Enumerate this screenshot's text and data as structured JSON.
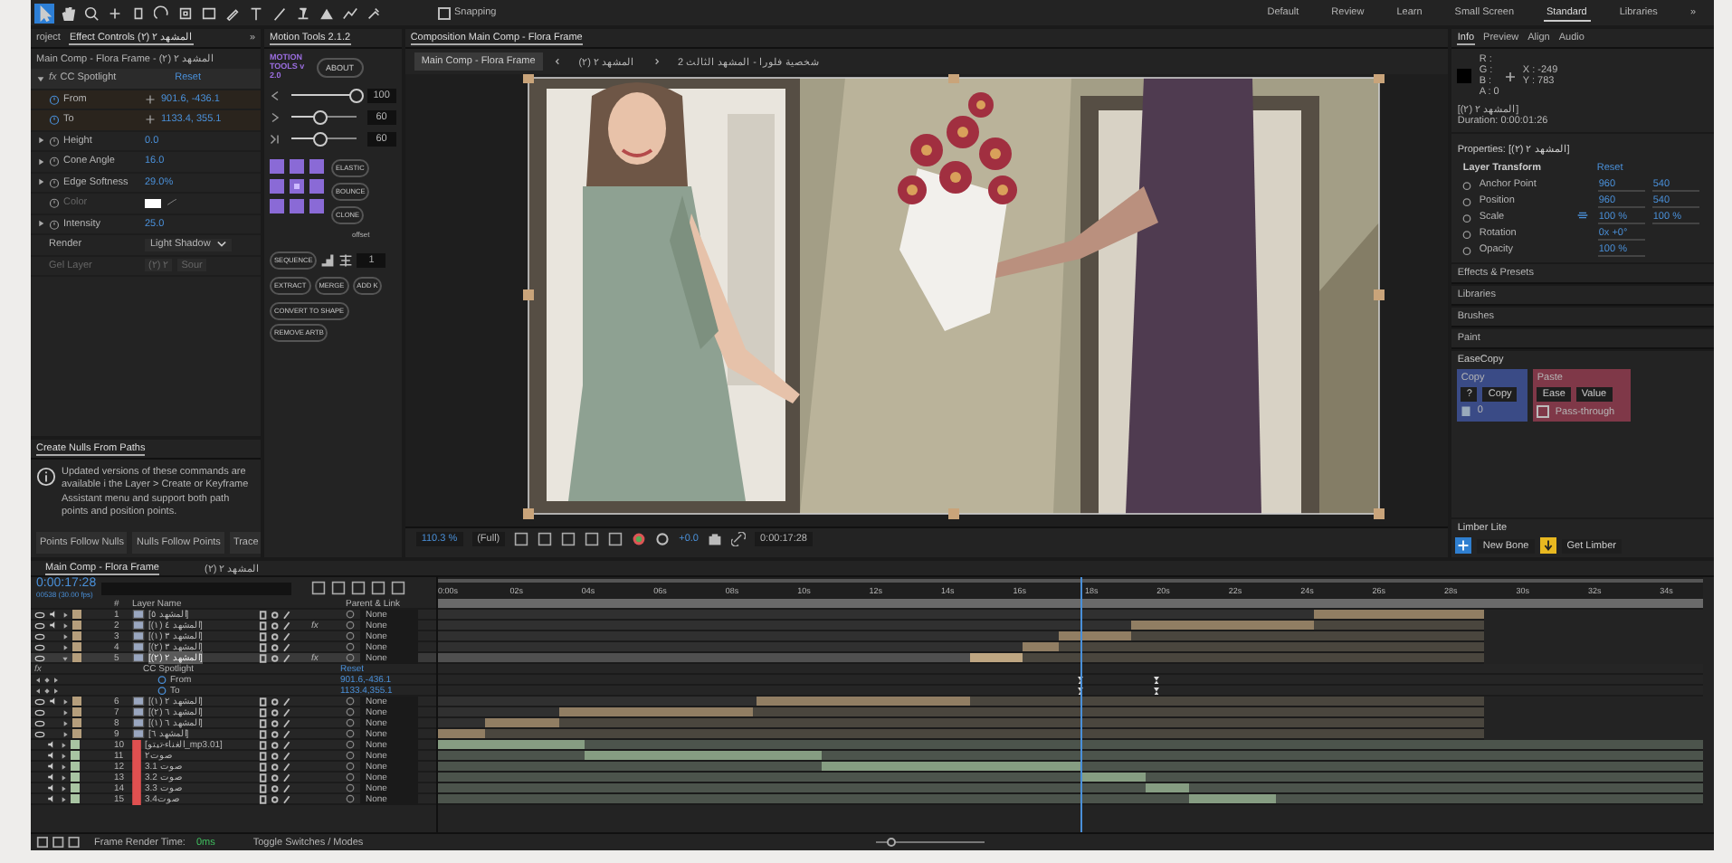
{
  "toolbar": {
    "tools": [
      {
        "selected": true
      },
      {
        "selected": false
      },
      {
        "selected": false
      },
      {
        "selected": false
      },
      {
        "selected": false
      },
      {
        "selected": false
      },
      {
        "selected": false
      },
      {
        "selected": false
      },
      {
        "selected": false
      },
      {
        "selected": false
      },
      {
        "selected": false
      },
      {
        "selected": false
      },
      {
        "selected": false
      },
      {
        "selected": false
      },
      {
        "selected": false
      }
    ],
    "snapping": {
      "label": "Snapping",
      "checked": false
    },
    "workspaces": [
      {
        "label": "Default",
        "selected": false
      },
      {
        "label": "Review",
        "selected": false
      },
      {
        "label": "Learn",
        "selected": false
      },
      {
        "label": "Small Screen",
        "selected": false
      },
      {
        "label": "Standard",
        "selected": true
      },
      {
        "label": "Libraries",
        "selected": false
      }
    ],
    "overflow": "»"
  },
  "effect_controls": {
    "tabs": [
      {
        "label": "roject",
        "selected": false
      },
      {
        "label": "Effect Controls المشهد ٢ (٢)",
        "selected": true
      }
    ],
    "overflow": "»",
    "breadcrumb": "Main Comp - Flora Frame - المشهد ٢ (٢)",
    "effect": {
      "fx_label": "fx",
      "name": "CC Spotlight",
      "reset": "Reset",
      "expanded": true
    },
    "properties": [
      {
        "kind": "point",
        "name": "From",
        "value": "901.6, -436.1",
        "expandable": false,
        "disabled": false
      },
      {
        "kind": "point",
        "name": "To",
        "value": "1133.4, 355.1",
        "expandable": false,
        "disabled": false
      },
      {
        "kind": "number",
        "name": "Height",
        "value": "0.0",
        "expandable": true,
        "disabled": false
      },
      {
        "kind": "number",
        "name": "Cone Angle",
        "value": "16.0",
        "expandable": true,
        "disabled": false
      },
      {
        "kind": "number",
        "name": "Edge Softness",
        "value": "29.0%",
        "expandable": true,
        "disabled": false
      },
      {
        "kind": "color",
        "name": "Color",
        "expandable": false,
        "disabled": true
      },
      {
        "kind": "number",
        "name": "Intensity",
        "value": "25.0",
        "expandable": true,
        "disabled": false
      },
      {
        "kind": "dropdown",
        "name": "Render",
        "value": "Light Shadow",
        "expandable": false,
        "disabled": false
      },
      {
        "kind": "dropdowns",
        "name": "Gel Layer",
        "value": "(٢) ٢",
        "value2": "Sour",
        "expandable": false,
        "disabled": true
      }
    ]
  },
  "create_nulls": {
    "title": "Create Nulls From Paths",
    "message": "Updated versions of these commands are available i the Layer > Create or Keyframe Assistant menu and support both path points and position points.",
    "buttons": [
      "Points Follow Nulls",
      "Nulls Follow Points",
      "Trace"
    ]
  },
  "motion_tools": {
    "title": "Motion Tools 2.1.2",
    "logo": "MOTION TOOLS v 2.0",
    "about": "ABOUT",
    "sliders": [
      {
        "level": 1,
        "value": "100"
      },
      {
        "level": 0.45,
        "value": "60"
      },
      {
        "level": 0.45,
        "value": "60"
      }
    ],
    "side_buttons": [
      "ELASTIC",
      "BOUNCE",
      "CLONE"
    ],
    "offset_label": "offset",
    "sequence": "SEQUENCE",
    "count": "1",
    "row_buttons": [
      "EXTRACT",
      "MERGE",
      "ADD K"
    ],
    "bottom_buttons": [
      "CONVERT TO SHAPE",
      "REMOVE ARTB"
    ]
  },
  "composition": {
    "tab": "Composition Main Comp - Flora Frame",
    "breadcrumbs": {
      "root": {
        "label": "Main Comp - Flora Frame",
        "selected": true
      },
      "middle": {
        "label": "المشهد ٢ (٢)",
        "selected": false
      },
      "end": {
        "label": "شخصية فلورا - المشهد الثالث 2",
        "selected": false
      }
    },
    "zoom": "110.3 %",
    "resolution": "(Full)",
    "exposure": "+0.0",
    "time": "0:00:17:28"
  },
  "info": {
    "tabs": [
      {
        "label": "Info",
        "selected": true
      },
      {
        "label": "Preview",
        "selected": false
      },
      {
        "label": "Align",
        "selected": false
      },
      {
        "label": "Audio",
        "selected": false
      }
    ],
    "channels": [
      "R :",
      "G :",
      "B :",
      "A : 0"
    ],
    "coords": [
      "X : -249",
      "Y : 783"
    ],
    "layer": "[المشهد ٢ (٢)]",
    "duration": "Duration: 0:00:01:26"
  },
  "properties": {
    "title": "Properties: [المشهد ٢ (٢)]",
    "group": "Layer Transform",
    "reset": "Reset",
    "rows": [
      {
        "name": "Anchor Point",
        "values": [
          "960",
          "540"
        ],
        "linked": false
      },
      {
        "name": "Position",
        "values": [
          "960",
          "540"
        ],
        "linked": false
      },
      {
        "name": "Scale",
        "values": [
          "100 %",
          "100 %"
        ],
        "linked": true
      },
      {
        "name": "Rotation",
        "values": [
          "0x +0°"
        ],
        "linked": false
      },
      {
        "name": "Opacity",
        "values": [
          "100 %"
        ],
        "linked": false
      }
    ]
  },
  "panels": [
    "Effects & Presets",
    "Libraries",
    "Brushes",
    "Paint"
  ],
  "easecopy": {
    "title": "EaseCopy",
    "copy_label": "Copy",
    "help": "?",
    "copy_button": "Copy",
    "count": "0",
    "paste_label": "Paste",
    "paste_buttons": [
      "Ease",
      "Value"
    ],
    "pass_through": {
      "label": "Pass-through",
      "checked": false
    }
  },
  "limber": {
    "title": "Limber Lite",
    "buttons": [
      {
        "kind": "bone",
        "label": "New Bone"
      },
      {
        "kind": "get",
        "label": "Get Limber"
      }
    ]
  },
  "timeline": {
    "tabs": [
      {
        "label": "Main Comp - Flora Frame",
        "selected": true
      },
      {
        "label": "المشهد ٢ (٢)",
        "selected": false
      }
    ],
    "time": "0:00:17:28",
    "frames": "00538 (30.00 fps)",
    "columns": {
      "number": "#",
      "name": "Layer Name",
      "parent": "Parent & Link"
    },
    "ticks": [
      "0:00s",
      "02s",
      "04s",
      "06s",
      "08s",
      "10s",
      "12s",
      "14s",
      "16s",
      "18s",
      "20s",
      "22s",
      "24s",
      "26s",
      "28s",
      "30s",
      "32s",
      "34s"
    ],
    "layers": [
      {
        "num": "1",
        "name": "[المشهد ٥]",
        "kind": "comp",
        "video": true,
        "audio": true,
        "fx": false,
        "selected": false,
        "expanded": false,
        "color": "#b59e7c",
        "parent": "None"
      },
      {
        "num": "2",
        "name": "[المشهد ٤ (١)]",
        "kind": "comp",
        "video": true,
        "audio": true,
        "fx": "fx",
        "selected": false,
        "expanded": false,
        "color": "#b59e7c",
        "parent": "None"
      },
      {
        "num": "3",
        "name": "[المشهد ٣ (١)]",
        "kind": "comp",
        "video": true,
        "audio": false,
        "fx": false,
        "selected": false,
        "expanded": false,
        "color": "#b59e7c",
        "parent": "None"
      },
      {
        "num": "4",
        "name": "[المشهد ٣ (٢)]",
        "kind": "comp",
        "video": true,
        "audio": false,
        "fx": false,
        "selected": false,
        "expanded": false,
        "color": "#b59e7c",
        "parent": "None"
      },
      {
        "num": "5",
        "name": "[المشهد ٢ (٢)]",
        "kind": "comp",
        "video": true,
        "audio": false,
        "fx": "fx",
        "selected": true,
        "expanded": true,
        "color": "#b59e7c",
        "parent": "None",
        "effects": [
          {
            "fx_label": "fx",
            "name": "CC Spotlight",
            "reset": "Reset",
            "properties": [
              {
                "name": "From",
                "value": "901.6,-436.1"
              },
              {
                "name": "To",
                "value": "1133.4,355.1"
              }
            ]
          }
        ]
      },
      {
        "num": "6",
        "name": "[المشهد ٢ (١)]",
        "kind": "comp",
        "video": true,
        "audio": true,
        "fx": false,
        "selected": false,
        "expanded": false,
        "color": "#b59e7c",
        "parent": "None"
      },
      {
        "num": "7",
        "name": "[المشهد ٦ (٢)]",
        "kind": "comp",
        "video": true,
        "audio": false,
        "fx": false,
        "selected": false,
        "expanded": false,
        "color": "#b59e7c",
        "parent": "None"
      },
      {
        "num": "8",
        "name": "[المشهد ٦ (١)]",
        "kind": "comp",
        "video": true,
        "audio": false,
        "fx": false,
        "selected": false,
        "expanded": false,
        "color": "#b59e7c",
        "parent": "None"
      },
      {
        "num": "9",
        "name": "[المشهد ٦]",
        "kind": "comp",
        "video": true,
        "audio": false,
        "fx": false,
        "selected": false,
        "expanded": false,
        "color": "#b59e7c",
        "parent": "None"
      },
      {
        "num": "10",
        "name": "[الغناء-تيتو_mp3.01]",
        "kind": "audio",
        "video": false,
        "audio": true,
        "fx": false,
        "selected": false,
        "expanded": false,
        "color": "#a8c4a2",
        "parent": "None"
      },
      {
        "num": "11",
        "name": "صوت٢",
        "kind": "audio",
        "video": false,
        "audio": true,
        "fx": false,
        "selected": false,
        "expanded": false,
        "color": "#a8c4a2",
        "parent": "None"
      },
      {
        "num": "12",
        "name": "صوت 3.1",
        "kind": "audio",
        "video": false,
        "audio": true,
        "fx": false,
        "selected": false,
        "expanded": false,
        "color": "#a8c4a2",
        "parent": "None"
      },
      {
        "num": "13",
        "name": "صوت 3.2",
        "kind": "audio",
        "video": false,
        "audio": true,
        "fx": false,
        "selected": false,
        "expanded": false,
        "color": "#a8c4a2",
        "parent": "None"
      },
      {
        "num": "14",
        "name": "صوت 3.3",
        "kind": "audio",
        "video": false,
        "audio": true,
        "fx": false,
        "selected": false,
        "expanded": false,
        "color": "#a8c4a2",
        "parent": "None"
      },
      {
        "num": "15",
        "name": "صوت3.4",
        "kind": "audio",
        "video": false,
        "audio": true,
        "fx": false,
        "selected": false,
        "expanded": false,
        "color": "#a8c4a2",
        "parent": "None"
      }
    ],
    "footer": {
      "render_label": "Frame Render Time:",
      "render_value": "0ms",
      "toggle": "Toggle Switches / Modes",
      "zoom": {
        "level": 0.15
      }
    }
  }
}
